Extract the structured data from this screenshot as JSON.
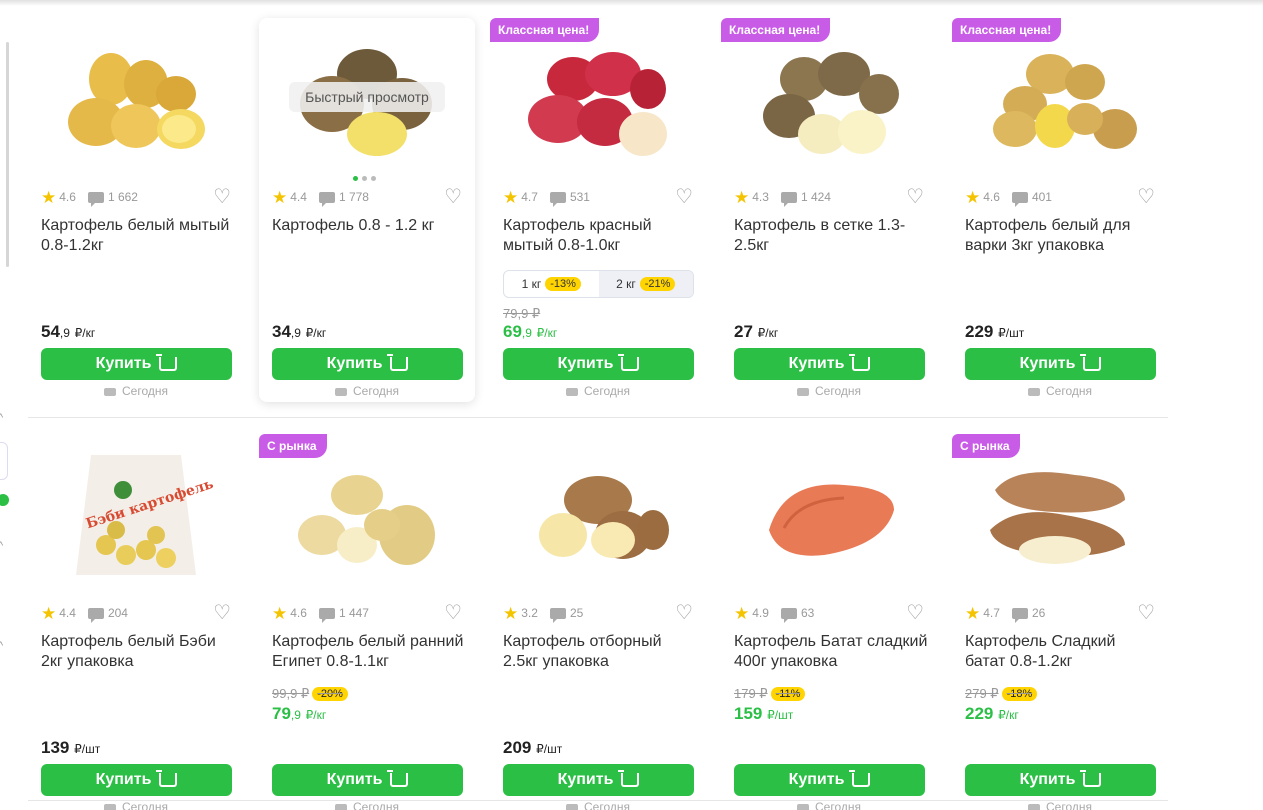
{
  "labels": {
    "buy": "Купить",
    "delivery": "Сегодня",
    "quick_view": "Быстрый просмотр"
  },
  "rows": [
    {
      "cards": [
        {
          "badge": "",
          "rating": "4.6",
          "reviews": "1 662",
          "title": "Картофель белый мытый 0.8-1.2кг",
          "old_price": "",
          "discount": "",
          "price_int": "54",
          "price_kop": ",9",
          "unit": "₽/кг",
          "sale": false,
          "image": "yellow-potatoes"
        },
        {
          "badge": "",
          "rating": "4.4",
          "reviews": "1 778",
          "title": "Картофель 0.8 - 1.2 кг",
          "old_price": "",
          "discount": "",
          "price_int": "34",
          "price_kop": ",9",
          "unit": "₽/кг",
          "sale": false,
          "image": "brown-potatoes"
        },
        {
          "badge": "Классная цена!",
          "rating": "4.7",
          "reviews": "531",
          "title": "Картофель красный мытый 0.8-1.0кг",
          "variants": [
            {
              "label": "1 кг",
              "discount": "-13%"
            },
            {
              "label": "2 кг",
              "discount": "-21%"
            }
          ],
          "old_price": "79,9 ₽",
          "discount": "",
          "price_int": "69",
          "price_kop": ",9",
          "unit": "₽/кг",
          "sale": true,
          "image": "red-potatoes"
        },
        {
          "badge": "Классная цена!",
          "rating": "4.3",
          "reviews": "1 424",
          "title": "Картофель в сетке 1.3-2.5кг",
          "old_price": "",
          "discount": "",
          "price_int": "27",
          "price_kop": "",
          "unit": "₽/кг",
          "sale": false,
          "image": "brown-potatoes-2"
        },
        {
          "badge": "Классная цена!",
          "rating": "4.6",
          "reviews": "401",
          "title": "Картофель белый для варки 3кг упаковка",
          "old_price": "",
          "discount": "",
          "price_int": "229",
          "price_kop": "",
          "unit": "₽/шт",
          "sale": false,
          "image": "yellow-potatoes-2"
        }
      ]
    },
    {
      "cards": [
        {
          "badge": "",
          "rating": "4.4",
          "reviews": "204",
          "title": "Картофель белый Бэби 2кг упаковка",
          "old_price": "",
          "discount": "",
          "price_int": "139",
          "price_kop": "",
          "unit": "₽/шт",
          "sale": false,
          "image": "baby-potato-bag",
          "bag_text": "Бэби картофель"
        },
        {
          "badge": "С рынка",
          "rating": "4.6",
          "reviews": "1 447",
          "title": "Картофель белый ранний Египет 0.8-1.1кг",
          "old_price": "99,9 ₽",
          "discount": "-20%",
          "price_int": "79",
          "price_kop": ",9",
          "unit": "₽/кг",
          "sale": true,
          "image": "early-potatoes"
        },
        {
          "badge": "",
          "rating": "3.2",
          "reviews": "25",
          "title": "Картофель отборный 2.5кг упаковка",
          "old_price": "",
          "discount": "",
          "price_int": "209",
          "price_kop": "",
          "unit": "₽/шт",
          "sale": false,
          "image": "select-potatoes"
        },
        {
          "badge": "",
          "rating": "4.9",
          "reviews": "63",
          "title": "Картофель Батат сладкий 400г упаковка",
          "old_price": "179 ₽",
          "discount": "-11%",
          "price_int": "159",
          "price_kop": "",
          "unit": "₽/шт",
          "sale": true,
          "image": "sweet-potato"
        },
        {
          "badge": "С рынка",
          "rating": "4.7",
          "reviews": "26",
          "title": "Картофель Сладкий батат 0.8-1.2кг",
          "old_price": "279 ₽",
          "discount": "-18%",
          "price_int": "229",
          "price_kop": "",
          "unit": "₽/кг",
          "sale": true,
          "image": "sweet-potatoes"
        }
      ]
    }
  ],
  "colors": {
    "accent_green": "#2bbf45",
    "badge_purple": "#c95ce6",
    "discount_yellow": "#ffd400",
    "star_yellow": "#f5c400"
  }
}
